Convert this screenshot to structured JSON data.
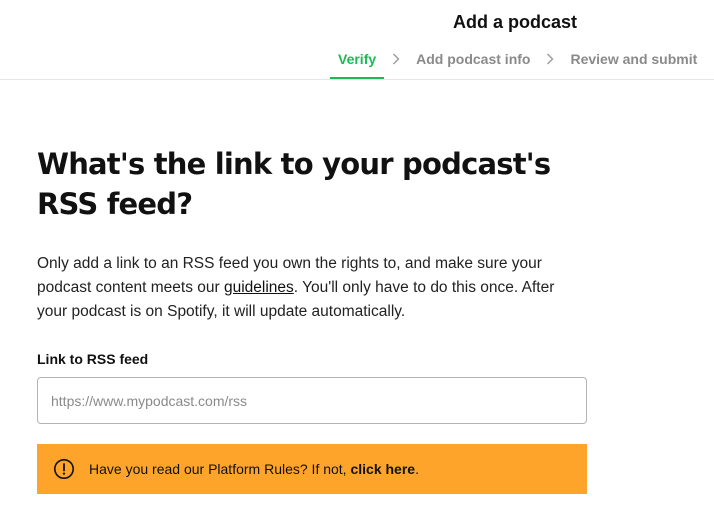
{
  "header": {
    "title": "Add a podcast",
    "steps": [
      {
        "label": "Verify",
        "active": true
      },
      {
        "label": "Add podcast info",
        "active": false
      },
      {
        "label": "Review and submit",
        "active": false
      }
    ]
  },
  "main": {
    "heading": "What's the link to your podcast's RSS feed?",
    "description": {
      "before_link": "Only add a link to an RSS feed you own the rights to, and make sure your podcast content meets our ",
      "link_text": "guidelines",
      "after_link": ". You'll only have to do this once. After your podcast is on Spotify, it will update automatically."
    },
    "rss_field": {
      "label": "Link to RSS feed",
      "placeholder": "https://www.mypodcast.com/rss",
      "value": ""
    },
    "notice": {
      "text": "Have you read our Platform Rules? If not, ",
      "link_text": "click here",
      "suffix": "."
    }
  },
  "colors": {
    "accent": "#1db954",
    "notice_bg": "#ffa42b",
    "muted_text": "#8a8a8a"
  },
  "icons": {
    "step_separator": "chevron-right-icon",
    "notice": "alert-circle-icon"
  }
}
